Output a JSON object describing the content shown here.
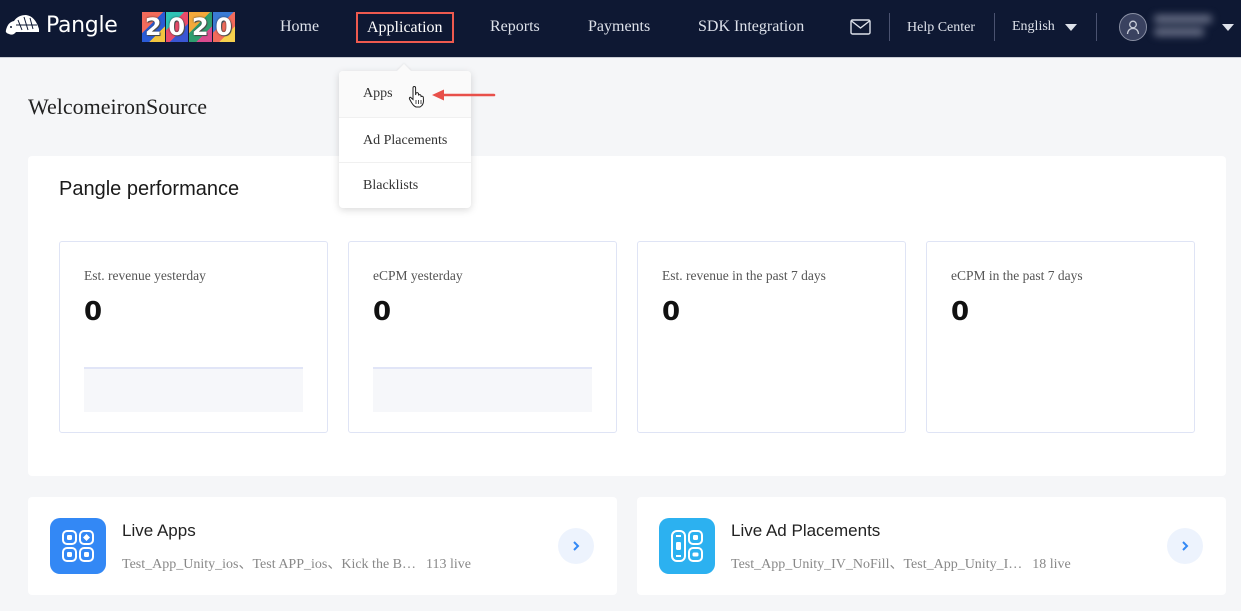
{
  "nav": {
    "brand": "Pangle",
    "badge_digits": [
      "2",
      "0",
      "2",
      "0"
    ],
    "items": [
      {
        "label": "Home"
      },
      {
        "label": "Application",
        "active": true
      },
      {
        "label": "Reports"
      },
      {
        "label": "Payments"
      },
      {
        "label": "SDK Integration"
      }
    ],
    "help_label": "Help Center",
    "language": "English",
    "icons": {
      "mail": "mail-icon",
      "user": "user-icon",
      "caret": "caret-down-icon"
    }
  },
  "dropdown": {
    "items": [
      {
        "label": "Apps",
        "hovered": true
      },
      {
        "label": "Ad Placements"
      },
      {
        "label": "Blacklists"
      }
    ]
  },
  "welcome": "WelcomeironSource",
  "performance": {
    "title": "Pangle performance",
    "metrics": [
      {
        "label": "Est. revenue yesterday",
        "value": "0"
      },
      {
        "label": "eCPM yesterday",
        "value": "0"
      },
      {
        "label": "Est. revenue in the past 7 days",
        "value": "0"
      },
      {
        "label": "eCPM in the past 7 days",
        "value": "0"
      }
    ]
  },
  "live": {
    "apps": {
      "title": "Live Apps",
      "items": "Test_App_Unity_ios、Test APP_ios、Kick the B…",
      "count": "113 live",
      "color": "#3388f5"
    },
    "placements": {
      "title": "Live Ad Placements",
      "items": "Test_App_Unity_IV_NoFill、Test_App_Unity_I…",
      "count": "18 live",
      "color": "#2cb1f0"
    }
  },
  "colors": {
    "nav_bg": "#0e1833",
    "highlight": "#ee5a4f",
    "accent": "#3388f5"
  }
}
